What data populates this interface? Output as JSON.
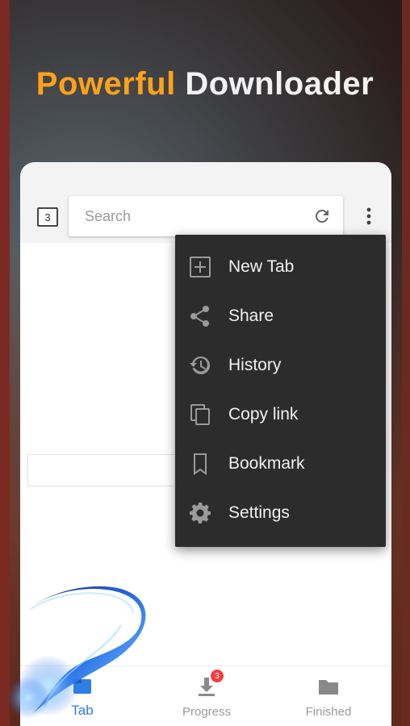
{
  "headline": {
    "accent": "Powerful",
    "rest": "Downloader"
  },
  "browser": {
    "tab_count": "3",
    "search": {
      "placeholder": "Search",
      "value": ""
    }
  },
  "menu": {
    "items": [
      {
        "label": "New Tab",
        "icon": "new-tab-icon"
      },
      {
        "label": "Share",
        "icon": "share-icon"
      },
      {
        "label": "History",
        "icon": "history-icon"
      },
      {
        "label": "Copy link",
        "icon": "copy-icon"
      },
      {
        "label": "Bookmark",
        "icon": "bookmark-icon"
      },
      {
        "label": "Settings",
        "icon": "gear-icon"
      }
    ]
  },
  "bottom_nav": {
    "items": [
      {
        "label": "Tab",
        "icon": "tab-icon",
        "active": true
      },
      {
        "label": "Progress",
        "icon": "download-icon",
        "badge": "3"
      },
      {
        "label": "Finished",
        "icon": "folder-icon"
      }
    ]
  },
  "colors": {
    "accent": "#ffa21a",
    "menu_bg": "#2c2c2c",
    "active_nav": "#2e7ee6",
    "badge": "#ef4040"
  }
}
